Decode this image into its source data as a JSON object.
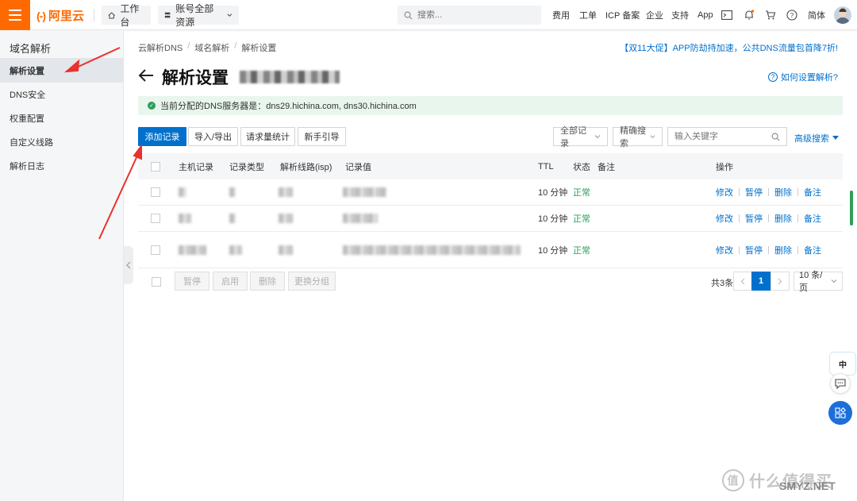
{
  "topbar": {
    "logo_text": "阿里云",
    "logo_mark": "(-)",
    "workbench_label": "工作台",
    "resources_label": "账号全部资源",
    "search_placeholder": "搜索...",
    "nav": [
      "费用",
      "工单",
      "ICP 备案",
      "企业",
      "支持",
      "App"
    ],
    "lang_label": "简体"
  },
  "sidebar": {
    "title": "域名解析",
    "items": [
      {
        "label": "解析设置",
        "active": true
      },
      {
        "label": "DNS安全",
        "active": false
      },
      {
        "label": "权重配置",
        "active": false
      },
      {
        "label": "自定义线路",
        "active": false
      },
      {
        "label": "解析日志",
        "active": false
      }
    ]
  },
  "breadcrumb": [
    "云解析DNS",
    "域名解析",
    "解析设置"
  ],
  "promo": "【双11大促】APP防劫持加速，公共DNS流量包首降7折!",
  "page": {
    "title": "解析设置",
    "help_label": "如何设置解析?"
  },
  "notice": {
    "text": "当前分配的DNS服务器是：dns29.hichina.com, dns30.hichina.com"
  },
  "toolbar": {
    "add_label": "添加记录",
    "import_label": "导入/导出",
    "stats_label": "请求量统计",
    "guide_label": "新手引导",
    "filter_all": "全部记录",
    "filter_exact": "精确搜索",
    "keyword_placeholder": "输入关键字",
    "advanced_label": "高级搜索"
  },
  "table": {
    "headers": {
      "host": "主机记录",
      "type": "记录类型",
      "line": "解析线路(isp)",
      "value": "记录值",
      "ttl": "TTL",
      "status": "状态",
      "remark": "备注",
      "actions": "操作"
    },
    "rows": [
      {
        "ttl": "10 分钟",
        "status": "正常"
      },
      {
        "ttl": "10 分钟",
        "status": "正常"
      },
      {
        "ttl": "10 分钟",
        "status": "正常"
      }
    ],
    "actions": [
      "修改",
      "暂停",
      "删除",
      "备注"
    ]
  },
  "footer": {
    "bulk": [
      "暂停",
      "启用",
      "删除",
      "更换分组"
    ],
    "total": "共3条",
    "current_page": "1",
    "page_size": "10 条/页"
  },
  "float": {
    "robot_label": "中"
  },
  "watermark": {
    "logo_char": "值",
    "text": "什么值得买",
    "overlay": "SMYZ.NET"
  },
  "colors": {
    "brand_orange": "#ff6a00",
    "primary_blue": "#0070cc",
    "success_green": "#2e9e5a",
    "annotation_red": "#e8322b"
  }
}
